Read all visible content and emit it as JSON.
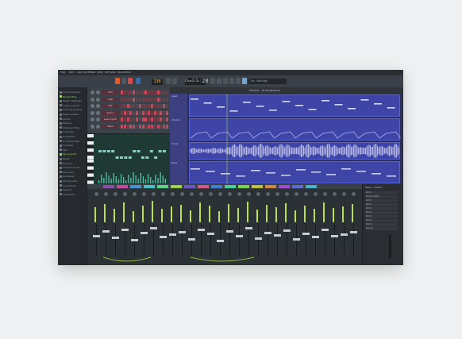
{
  "window": {
    "title": "FL Studio 20",
    "hint_text": "Tip: Settings"
  },
  "menu": [
    "FILE",
    "EDIT",
    "ADD",
    "PATTERNS",
    "VIEW",
    "OPTIONS",
    "TOOLS",
    "HELP"
  ],
  "transport": {
    "tempo": "130",
    "song_position": "6:16:28",
    "pattern": "Pattern 24"
  },
  "browser": {
    "items": [
      {
        "label": "Current project",
        "highlight": false
      },
      {
        "label": "Recent files",
        "highlight": true
      },
      {
        "label": "Plugin database",
        "highlight": false
      },
      {
        "label": "Plugin presets",
        "highlight": false
      },
      {
        "label": "Channel presets",
        "highlight": false
      },
      {
        "label": "Mixer presets",
        "highlight": false
      },
      {
        "label": "Scores",
        "highlight": false
      },
      {
        "label": "Backup",
        "highlight": false
      },
      {
        "label": "Clipboard files",
        "highlight": false
      },
      {
        "label": "Collected",
        "highlight": false
      },
      {
        "label": "Envelopes",
        "highlight": false
      },
      {
        "label": "IL shared data",
        "highlight": false
      },
      {
        "label": "Impulses",
        "highlight": false
      },
      {
        "label": "Misc",
        "highlight": false
      },
      {
        "label": "My projects",
        "highlight": true
      },
      {
        "label": "Packs",
        "highlight": false
      },
      {
        "label": "Projects",
        "highlight": false
      },
      {
        "label": "Projects bones",
        "highlight": false
      },
      {
        "label": "Recorded",
        "highlight": false
      },
      {
        "label": "Rendered",
        "highlight": false
      },
      {
        "label": "Sliced audio",
        "highlight": false
      },
      {
        "label": "Soundfonts",
        "highlight": false
      },
      {
        "label": "Speech",
        "highlight": false
      },
      {
        "label": "Templates",
        "highlight": false
      }
    ]
  },
  "channel_rack": {
    "channels": [
      {
        "name": "Kick",
        "steps": [
          1,
          0,
          0,
          0,
          1,
          0,
          0,
          0,
          1,
          0,
          0,
          0,
          1,
          0,
          0,
          0
        ]
      },
      {
        "name": "Clap",
        "steps": [
          0,
          0,
          0,
          0,
          1,
          0,
          0,
          0,
          0,
          0,
          0,
          0,
          1,
          0,
          0,
          0
        ]
      },
      {
        "name": "Hat",
        "steps": [
          0,
          0,
          1,
          0,
          0,
          0,
          1,
          0,
          0,
          0,
          1,
          0,
          0,
          0,
          1,
          0
        ]
      },
      {
        "name": "Snare",
        "steps": [
          0,
          1,
          0,
          1,
          0,
          1,
          0,
          1,
          0,
          1,
          0,
          1,
          0,
          1,
          0,
          1
        ]
      },
      {
        "name": "Lead synth",
        "steps": [
          1,
          0,
          1,
          0,
          0,
          1,
          0,
          1,
          1,
          0,
          1,
          0,
          0,
          1,
          0,
          1
        ]
      },
      {
        "name": "Bass",
        "steps": [
          1,
          1,
          0,
          1,
          1,
          0,
          1,
          1,
          0,
          1,
          1,
          0,
          1,
          0,
          1,
          1
        ]
      }
    ]
  },
  "playlist": {
    "title": "Playlist - Arrangement",
    "tracks": [
      {
        "name": "Lead"
      },
      {
        "name": "Chords"
      },
      {
        "name": "Vocal"
      },
      {
        "name": "Bass"
      }
    ]
  },
  "mixer": {
    "title": "Mixer - Master",
    "channel_count": 28,
    "levels": [
      0.62,
      0.78,
      0.55,
      0.84,
      0.47,
      0.71,
      0.9,
      0.58,
      0.66,
      0.74,
      0.51,
      0.82,
      0.69,
      0.45,
      0.77,
      0.6,
      0.88,
      0.53,
      0.72,
      0.64,
      0.8,
      0.49,
      0.7,
      0.57,
      0.83,
      0.61,
      0.68,
      0.75
    ],
    "fx_slots": [
      "Slot 1",
      "Fruity Limiter",
      "Slot 3",
      "Slot 4",
      "Slot 5",
      "Slot 6",
      "Slot 7",
      "Slot 8",
      "Slot 9",
      "Slot 10"
    ]
  },
  "colors": {
    "accent": "#8fdc55",
    "playlist_bg": "#2b2f55",
    "clip": "#3e45a6",
    "channel_step_on": "#c4485e",
    "meter": "#b8e04a"
  }
}
